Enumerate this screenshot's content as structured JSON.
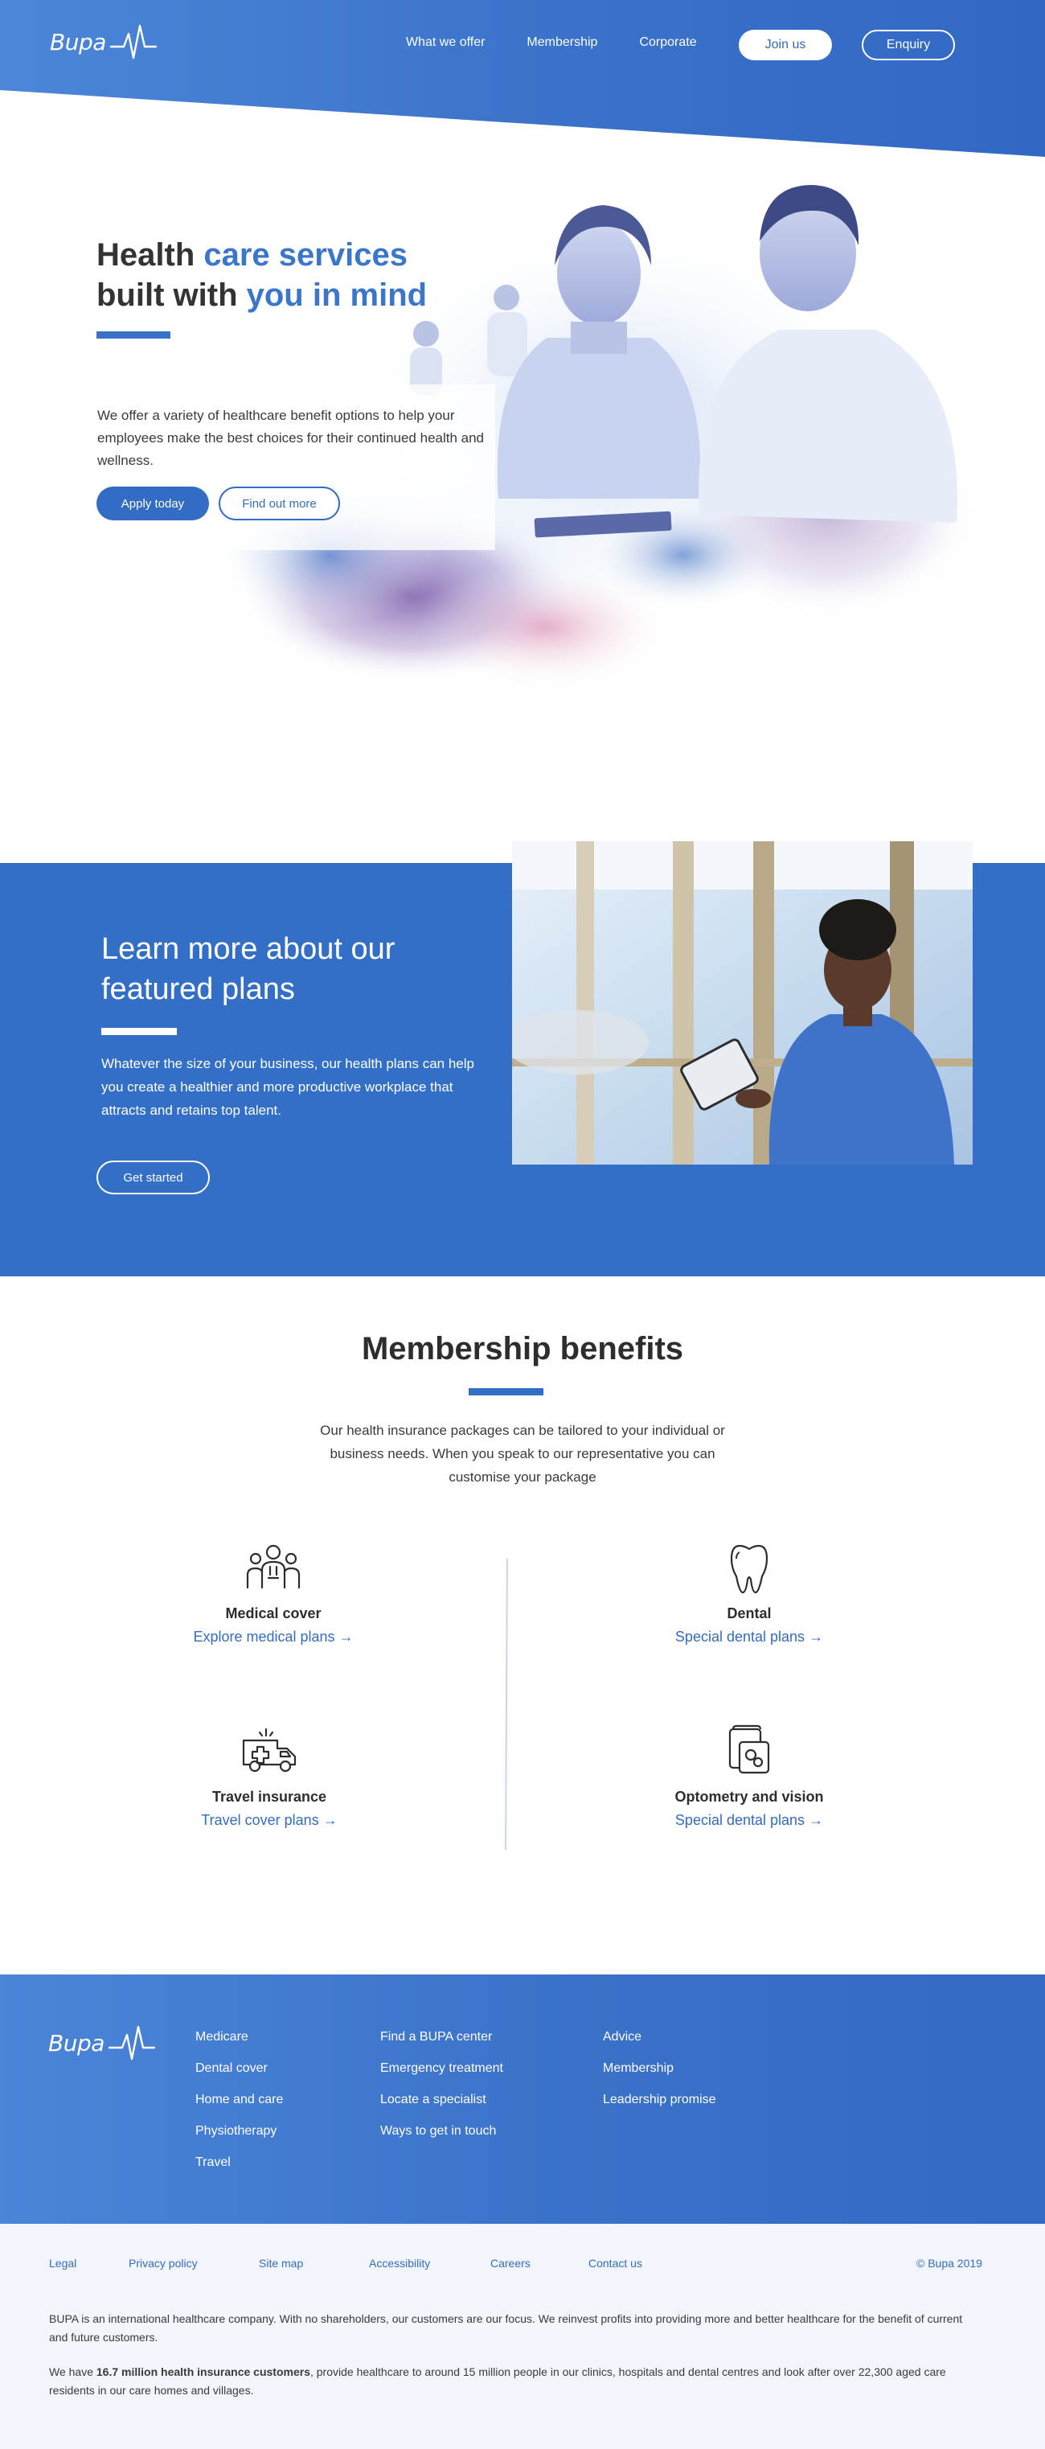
{
  "header": {
    "brand": "Bupa",
    "nav": [
      "What we offer",
      "Membership",
      "Corporate"
    ],
    "join_label": "Join us",
    "enquiry_label": "Enquiry"
  },
  "hero": {
    "title_line1_a": "Health ",
    "title_line1_b": "care services",
    "title_line2_a": "built with ",
    "title_line2_b": "you in mind",
    "text": "We offer a variety of healthcare benefit options to help your employees make the best choices for their continued health and wellness.",
    "primary_button": "Apply today",
    "secondary_button": "Find out more"
  },
  "featured": {
    "title": "Learn more about our featured plans",
    "text": "Whatever the size of your business, our health plans can help you create a healthier and more productive workplace that attracts and retains top talent.",
    "button": "Get started"
  },
  "benefits": {
    "title": "Membership benefits",
    "intro": "Our health insurance packages can be tailored to your individual or business needs. When you speak to our representative you can customise your package",
    "items": [
      {
        "icon": "medical-team-icon",
        "name": "Medical cover",
        "link": "Explore medical plans"
      },
      {
        "icon": "tooth-icon",
        "name": "Dental",
        "link": "Special dental plans"
      },
      {
        "icon": "ambulance-icon",
        "name": "Travel insurance",
        "link": "Travel cover plans"
      },
      {
        "icon": "eye-card-icon",
        "name": "Optometry and vision",
        "link": "Special dental plans"
      }
    ]
  },
  "footer": {
    "brand": "Bupa",
    "col1": [
      "Medicare",
      "Dental cover",
      "Home and care",
      "Physiotherapy",
      "Travel"
    ],
    "col2": [
      "Find a BUPA center",
      "Emergency treatment",
      "Locate a specialist",
      "Ways to get in touch"
    ],
    "col3": [
      "Advice",
      "Membership",
      "Leadership promise"
    ],
    "legal_links": [
      "Legal",
      "Privacy policy",
      "Site map",
      "Accessibility",
      "Careers",
      "Contact us"
    ],
    "copyright": "© Bupa 2019",
    "para1": "BUPA is an international healthcare company. With no shareholders, our customers are our focus. We reinvest profits into providing more and better healthcare for the benefit of current and future customers.",
    "para2_a": "We have ",
    "para2_b": "16.7 million health insurance customers",
    "para2_c": ", provide healthcare to around 15 million people in our clinics, hospitals and dental centres and look after over 22,300 aged care residents in our care homes and villages."
  },
  "colors": {
    "primary": "#336fc6",
    "accent_text": "#3a76cc",
    "legal_bg": "#f2f5fb"
  }
}
